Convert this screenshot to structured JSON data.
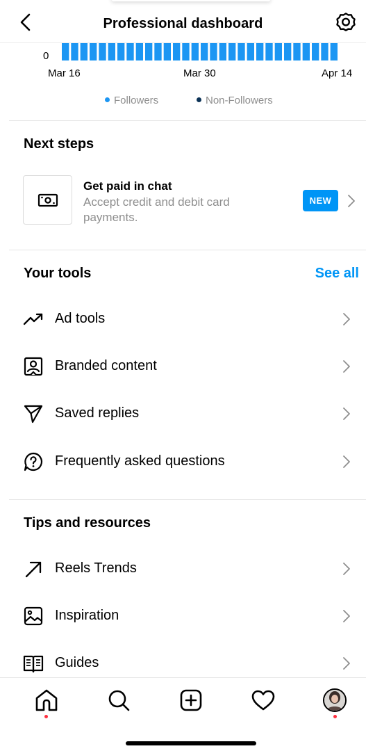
{
  "header": {
    "title": "Professional dashboard",
    "back_icon": "chevron-left-icon",
    "settings_icon": "gear-icon"
  },
  "chart_data": {
    "type": "bar",
    "y_tick_label": "0",
    "x_tick_labels": [
      "Mar 16",
      "Mar 30",
      "Apr 14"
    ],
    "legend": [
      {
        "name": "Followers",
        "color": "#1c96f3"
      },
      {
        "name": "Non-Followers",
        "color": "#0b3256"
      }
    ],
    "bar_count": 30,
    "bar_color": "#1c96f3"
  },
  "next_steps": {
    "title": "Next steps",
    "item": {
      "icon": "cash-icon",
      "title": "Get paid in chat",
      "description": "Accept credit and debit card payments.",
      "badge": "NEW"
    }
  },
  "your_tools": {
    "title": "Your tools",
    "see_all": "See all",
    "items": [
      {
        "label": "Ad tools",
        "icon": "trending-up-icon"
      },
      {
        "label": "Branded content",
        "icon": "branded-content-icon"
      },
      {
        "label": "Saved replies",
        "icon": "send-icon"
      },
      {
        "label": "Frequently asked questions",
        "icon": "faq-icon"
      }
    ]
  },
  "tips": {
    "title": "Tips and resources",
    "items": [
      {
        "label": "Reels Trends",
        "icon": "arrow-up-right-icon"
      },
      {
        "label": "Inspiration",
        "icon": "image-icon"
      },
      {
        "label": "Guides",
        "icon": "guides-icon"
      }
    ]
  },
  "bottom_nav": {
    "items": [
      "home-icon",
      "search-icon",
      "create-icon",
      "heart-icon",
      "profile-avatar"
    ],
    "accent": "#ff3040"
  }
}
